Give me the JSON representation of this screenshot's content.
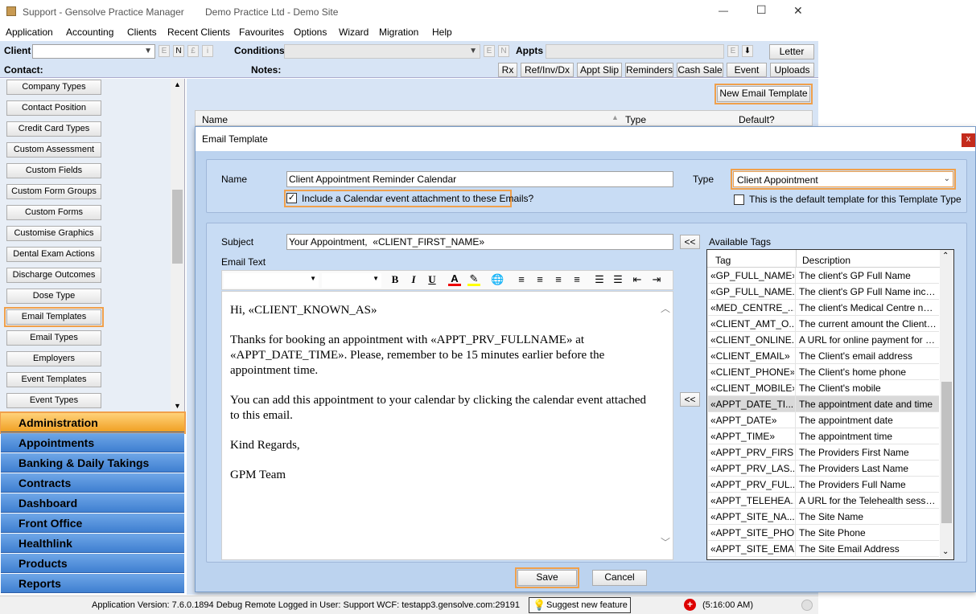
{
  "app": {
    "title": "Support - Gensolve Practice Manager",
    "site": "Demo Practice Ltd - Demo Site",
    "window_controls": {
      "minimize": "—",
      "maximize": "☐",
      "close": "✕"
    }
  },
  "menu": [
    "Application",
    "Accounting",
    "Clients",
    "Recent Clients",
    "Favourites",
    "Options",
    "Wizard",
    "Migration",
    "Help"
  ],
  "toolbar": {
    "client_label": "Client",
    "client_buttons": [
      "E",
      "N",
      "£",
      "i"
    ],
    "conditions_label": "Conditions",
    "conditions_buttons": [
      "E",
      "N"
    ],
    "appts_label": "Appts",
    "letter_label": "Letter",
    "contact_label": "Contact:",
    "notes_label": "Notes:",
    "action_buttons": [
      "Rx",
      "Ref/Inv/Dx",
      "Appt Slip",
      "Reminders",
      "Cash Sale",
      "Event",
      "Uploads"
    ]
  },
  "sidebar": {
    "items": [
      "Company Types",
      "Contact Position",
      "Credit Card Types",
      "Custom Assessment",
      "Custom Fields",
      "Custom Form Groups",
      "Custom Forms",
      "Customise Graphics",
      "Dental Exam Actions",
      "Discharge Outcomes",
      "Dose Type",
      "Email Templates",
      "Email Types",
      "Employers",
      "Event Templates",
      "Event Types"
    ],
    "selected": "Email Templates",
    "nav": [
      "Administration",
      "Appointments",
      "Banking & Daily Takings",
      "Contracts",
      "Dashboard",
      "Front Office",
      "Healthlink",
      "Products",
      "Reports"
    ],
    "nav_active": "Administration"
  },
  "main": {
    "new_template_label": "New Email Template",
    "grid_headers": [
      "Name",
      "Type",
      "Default?"
    ]
  },
  "dialog": {
    "title": "Email Template",
    "close": "x",
    "name_label": "Name",
    "name_value": "Client Appointment Reminder Calendar",
    "type_label": "Type",
    "type_value": "Client Appointment",
    "calendar_checkbox_label": "Include a Calendar event attachment to these Emails?",
    "calendar_checked": true,
    "default_checkbox_label": "This is the default template for this Template Type",
    "default_checked": false,
    "subject_label": "Subject",
    "subject_value": "Your Appointment,  «CLIENT_FIRST_NAME»",
    "email_text_label": "Email Text",
    "insert_label": "<<",
    "body": [
      "Hi, «CLIENT_KNOWN_AS»",
      "Thanks for booking an appointment with «APPT_PRV_FULLNAME» at «APPT_DATE_TIME». Please, remember to be 15 minutes earlier before the appointment time.",
      "You can add this appointment to your calendar by clicking the calendar event attached to this email.",
      "Kind Regards,",
      "GPM Team"
    ],
    "tags_label": "Available Tags",
    "tags_headers": [
      "Tag",
      "Description"
    ],
    "tags": [
      [
        "«GP_FULL_NAME»",
        "The client's GP Full Name"
      ],
      [
        "«GP_FULL_NAME...",
        "The client's GP Full Name includi..."
      ],
      [
        "«MED_CENTRE_...",
        "The client's Medical Centre name"
      ],
      [
        "«CLIENT_AMT_O...",
        "The current amount the Client owes"
      ],
      [
        "«CLIENT_ONLINE...",
        "A URL for online payment for the ..."
      ],
      [
        "«CLIENT_EMAIL»",
        "The Client's email address"
      ],
      [
        "«CLIENT_PHONE»",
        "The Client's home phone"
      ],
      [
        "«CLIENT_MOBILE»",
        "The Client's mobile"
      ],
      [
        "«APPT_DATE_TI...",
        "The appointment date and time"
      ],
      [
        "«APPT_DATE»",
        "The appointment date"
      ],
      [
        "«APPT_TIME»",
        "The appointment time"
      ],
      [
        "«APPT_PRV_FIRS...",
        "The Providers First Name"
      ],
      [
        "«APPT_PRV_LAS...",
        "The Providers Last Name"
      ],
      [
        "«APPT_PRV_FUL...",
        "The Providers Full Name"
      ],
      [
        "«APPT_TELEHEA...",
        "A URL for the Telehealth session ..."
      ],
      [
        "«APPT_SITE_NA...",
        "The Site Name"
      ],
      [
        "«APPT_SITE_PHO...",
        "The Site Phone"
      ],
      [
        "«APPT_SITE_EMA...",
        "The Site Email Address"
      ]
    ],
    "selected_tag_index": 8,
    "save_label": "Save",
    "cancel_label": "Cancel"
  },
  "status": {
    "version": "Application Version: 7.6.0.1894 Debug Remote  Logged in User: Support WCF: testapp3.gensolve.com:29191",
    "suggest": "Suggest new feature",
    "time": "(5:16:00 AM)"
  },
  "colors": {
    "accent": "#f0a04b",
    "panel": "#c8dcf4",
    "nav": "#4a8ad8",
    "bg": "#d7e4f5"
  }
}
